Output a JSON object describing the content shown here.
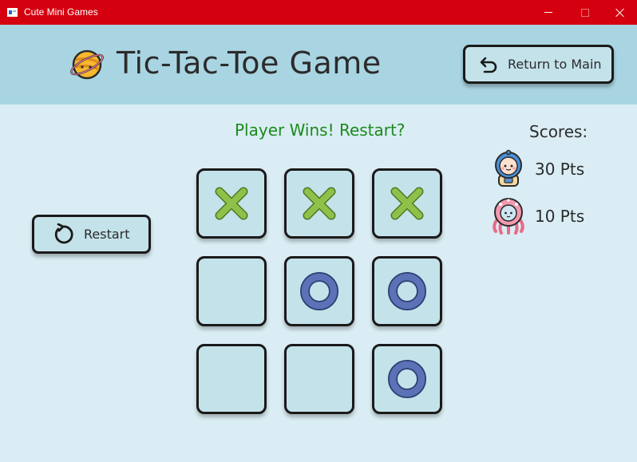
{
  "window": {
    "title": "Cute Mini Games",
    "controls": [
      "minimize",
      "maximize",
      "close"
    ]
  },
  "header": {
    "title": "Tic-Tac-Toe Game",
    "icon": "planet-icon",
    "return_button": {
      "label": "Return to Main",
      "icon": "undo-arrow-icon"
    }
  },
  "status": {
    "message": "Player Wins! Restart?",
    "color": "#1b8a1b"
  },
  "restart_button": {
    "label": "Restart",
    "icon": "restart-arrow-icon"
  },
  "board": {
    "cells": [
      [
        "X",
        "X",
        "X"
      ],
      [
        "",
        "O",
        "O"
      ],
      [
        "",
        "",
        "O"
      ]
    ],
    "x_color": "#8fc04a",
    "o_color": "#5b72b7"
  },
  "scores": {
    "label": "Scores:",
    "players": [
      {
        "avatar": "astronaut-avatar-icon",
        "value": "30 Pts"
      },
      {
        "avatar": "octopus-avatar-icon",
        "value": "10 Pts"
      }
    ]
  },
  "colors": {
    "titlebar": "#d5000f",
    "header": "#a9d5e2",
    "background": "#daedf4",
    "tile": "#c4e2ea"
  }
}
